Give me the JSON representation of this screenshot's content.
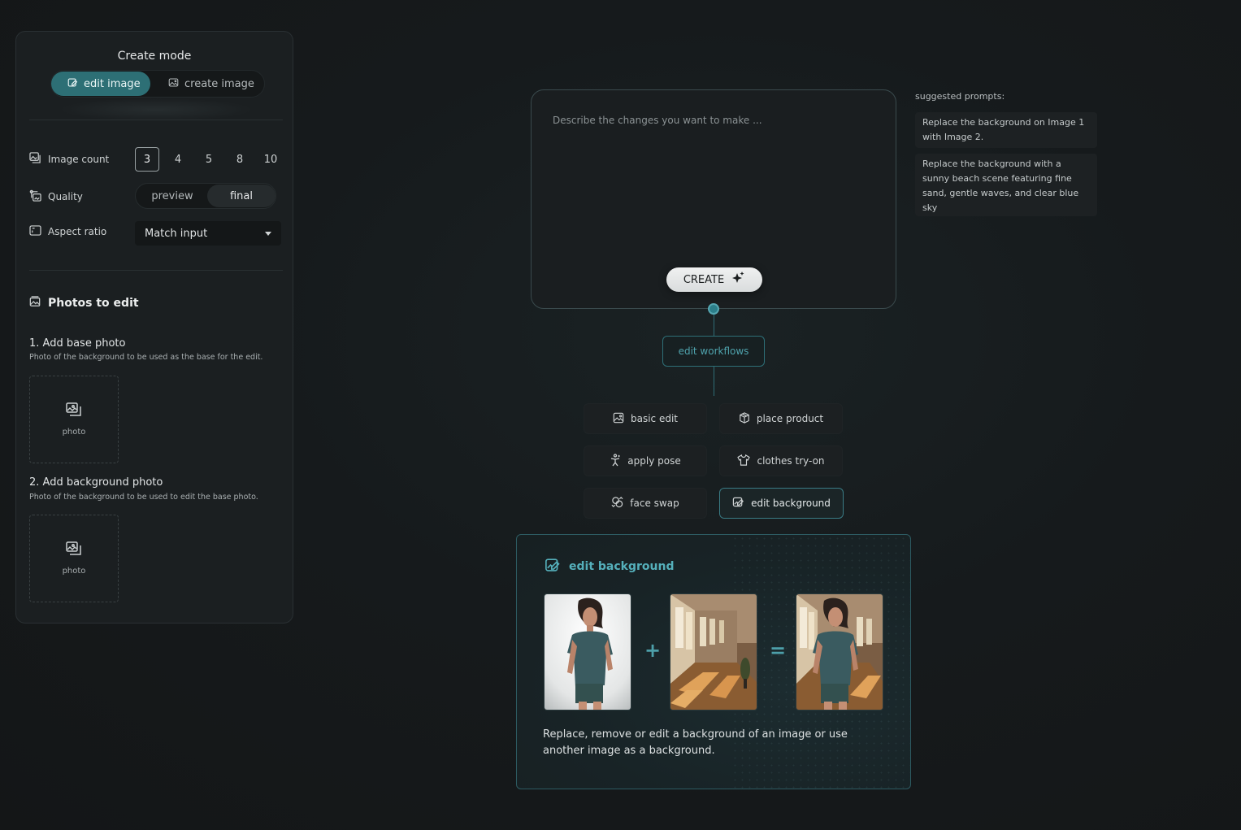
{
  "panel": {
    "title": "Create mode",
    "modes": [
      {
        "label": "edit image",
        "active": true
      },
      {
        "label": "create image",
        "active": false
      }
    ],
    "image_count": {
      "label": "Image count",
      "options": [
        "3",
        "4",
        "5",
        "8",
        "10"
      ],
      "selected": "3"
    },
    "quality": {
      "label": "Quality",
      "options": [
        "preview",
        "final"
      ],
      "selected": "final"
    },
    "aspect_ratio": {
      "label": "Aspect ratio",
      "value": "Match input"
    },
    "photos_section": "Photos to edit",
    "steps": [
      {
        "title": "1. Add base photo",
        "sub": "Photo of the background to be used as the base for the edit.",
        "drop_label": "photo"
      },
      {
        "title": "2. Add background photo",
        "sub": "Photo of the background to be used to edit the base photo.",
        "drop_label": "photo"
      }
    ]
  },
  "prompt": {
    "placeholder": "Describe the changes you want to make ...",
    "create_label": "CREATE"
  },
  "workflows": {
    "label": "edit workflows",
    "items": [
      {
        "label": "basic edit",
        "icon": "image-icon"
      },
      {
        "label": "place product",
        "icon": "box-icon"
      },
      {
        "label": "apply pose",
        "icon": "pose-icon"
      },
      {
        "label": "clothes try-on",
        "icon": "shirt-icon"
      },
      {
        "label": "face swap",
        "icon": "face-swap-icon"
      },
      {
        "label": "edit background",
        "icon": "edit-image-icon",
        "selected": true
      }
    ]
  },
  "suggested": {
    "title": "suggested prompts:",
    "items": [
      "Replace the background on Image 1 with Image 2.",
      "Replace the background with a sunny beach scene featuring fine sand, gentle waves, and clear blue sky"
    ]
  },
  "card": {
    "title": "edit background",
    "plus": "+",
    "equals": "=",
    "description": "Replace, remove or edit a background of an image or use another image as a background."
  },
  "colors": {
    "accent": "#2d6f75",
    "accent_text": "#55b0bb",
    "panel_bg": "#1b1f21",
    "page_bg": "#161a1c"
  }
}
